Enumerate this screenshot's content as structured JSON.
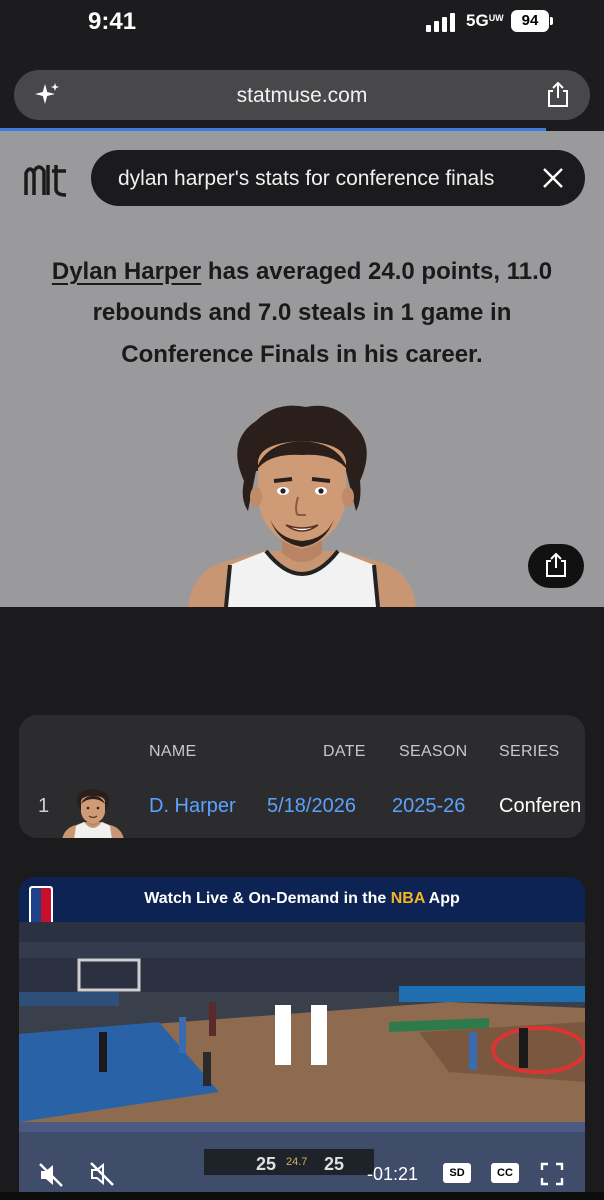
{
  "status_bar": {
    "time": "9:41",
    "network": "5G",
    "network_sub": "UW",
    "battery": "94"
  },
  "browser": {
    "url": "statmuse.com",
    "icons": [
      "sparkle-icon",
      "share-icon"
    ]
  },
  "search": {
    "query": "dylan harper's stats for conference finals",
    "icons": [
      "statmuse-logo-icon",
      "close-icon"
    ]
  },
  "answer": {
    "player": "Dylan Harper",
    "text": " has averaged 24.0 points, 11.0 rebounds and 7.0 steals in 1 game in Conference Finals in his career."
  },
  "table": {
    "headers": {
      "name": "NAME",
      "date": "DATE",
      "season": "SEASON",
      "series": "SERIES"
    },
    "rows": [
      {
        "rank": "1",
        "name": "D. Harper",
        "date": "5/18/2026",
        "season": "2025-26",
        "series": "Conferen"
      }
    ]
  },
  "video": {
    "header_prefix": "Watch Live & On-Demand in the ",
    "header_accent": "NBA",
    "header_suffix": " App",
    "score_left": "25",
    "score_right": "25",
    "shot_clock": "24.7",
    "time_remaining": "-01:21",
    "quality_badge": "SD",
    "captions_badge": "CC"
  },
  "colors": {
    "accent_blue": "#5aa2ff",
    "hero_bg": "#9a9a9c",
    "nba_gold": "#f5b325",
    "nba_navy": "#0d2353"
  }
}
